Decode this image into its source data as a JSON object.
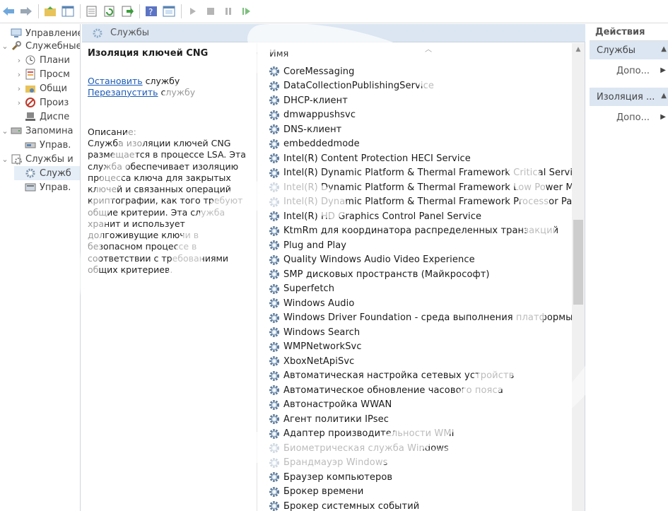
{
  "toolbar": {
    "buttons": [
      "back",
      "forward",
      "up-folder",
      "show-hide-tree",
      "export-list",
      "refresh",
      "export",
      "help",
      "properties-view",
      "start-service",
      "stop-service",
      "pause-service",
      "resume-service"
    ]
  },
  "tree": {
    "items": [
      {
        "label": "Управление к",
        "level": 0,
        "chevron": "",
        "icon": "computer-icon"
      },
      {
        "label": "Служебные",
        "level": 0,
        "chevron": "⌄",
        "icon": "tools-icon"
      },
      {
        "label": "Плани",
        "level": 1,
        "chevron": "›",
        "icon": "clock-icon"
      },
      {
        "label": "Просм",
        "level": 1,
        "chevron": "›",
        "icon": "event-viewer-icon"
      },
      {
        "label": "Общи",
        "level": 1,
        "chevron": "›",
        "icon": "shared-folders-icon"
      },
      {
        "label": "Произ",
        "level": 1,
        "chevron": "›",
        "icon": "performance-icon"
      },
      {
        "label": "Диспе",
        "level": 1,
        "chevron": "",
        "icon": "device-manager-icon"
      },
      {
        "label": "Запомина",
        "level": 0,
        "chevron": "⌄",
        "icon": "storage-icon"
      },
      {
        "label": "Управ.",
        "level": 1,
        "chevron": "",
        "icon": "disk-management-icon"
      },
      {
        "label": "Службы и",
        "level": 0,
        "chevron": "⌄",
        "icon": "services-apps-icon"
      },
      {
        "label": "Служб",
        "level": 1,
        "chevron": "",
        "icon": "services-gear-icon",
        "selected": true
      },
      {
        "label": "Управ.",
        "level": 1,
        "chevron": "",
        "icon": "wmi-control-icon"
      }
    ]
  },
  "center": {
    "header_title": "Службы",
    "desc_title": "Изоляция ключей CNG",
    "stop_link": "Остановить",
    "stop_suffix": " службу",
    "restart_link": "Перезапустить",
    "restart_suffix": " службу",
    "desc_label": "Описание:",
    "desc_text": "Служба изоляции ключей CNG размещается в процессе LSA. Эта служба обеспечивает изоляцию процесса ключа для закрытых ключей и связанных операций криптографии, как того требуют общие критерии. Эта служба хранит и использует долгоживущие ключи в безопасном процессе в соответствии с требованиями общих критериев."
  },
  "list": {
    "column_name": "Имя",
    "services": [
      "CoreMessaging",
      "DataCollectionPublishingService",
      "DHCP-клиент",
      "dmwappushsvc",
      "DNS-клиент",
      "embeddedmode",
      "Intel(R) Content Protection HECI Service",
      "Intel(R) Dynamic Platform & Thermal Framework Critical Service",
      "Intel(R) Dynamic Platform & Thermal Framework Low Power M",
      "Intel(R) Dynamic Platform & Thermal Framework Processor Part",
      "Intel(R) HD Graphics Control Panel Service",
      "KtmRm для координатора распределенных транзакций",
      "Plug and Play",
      "Quality Windows Audio Video Experience",
      "SMP дисковых пространств (Майкрософт)",
      "Superfetch",
      "Windows Audio",
      "Windows Driver Foundation - среда выполнения платформы д",
      "Windows Search",
      "WMPNetworkSvc",
      "XboxNetApiSvc",
      "Автоматическая настройка сетевых устройств",
      "Автоматическое обновление часового пояса",
      "Автонастройка WWAN",
      "Агент политики IPsec",
      "Адаптер производительности WMI",
      "Биометрическая служба Windows",
      "Брандмауэр Windows",
      "Браузер компьютеров",
      "Брокер времени",
      "Брокер системных событий"
    ]
  },
  "actions": {
    "title": "Действия",
    "group1": "Службы",
    "group1_item": "Допо...",
    "group2": "Изоляция ...",
    "group2_item": "Допо..."
  },
  "colors": {
    "header_bg": "#dbe6f2",
    "link": "#1a5bb8",
    "gear": "#4a7fb8"
  }
}
